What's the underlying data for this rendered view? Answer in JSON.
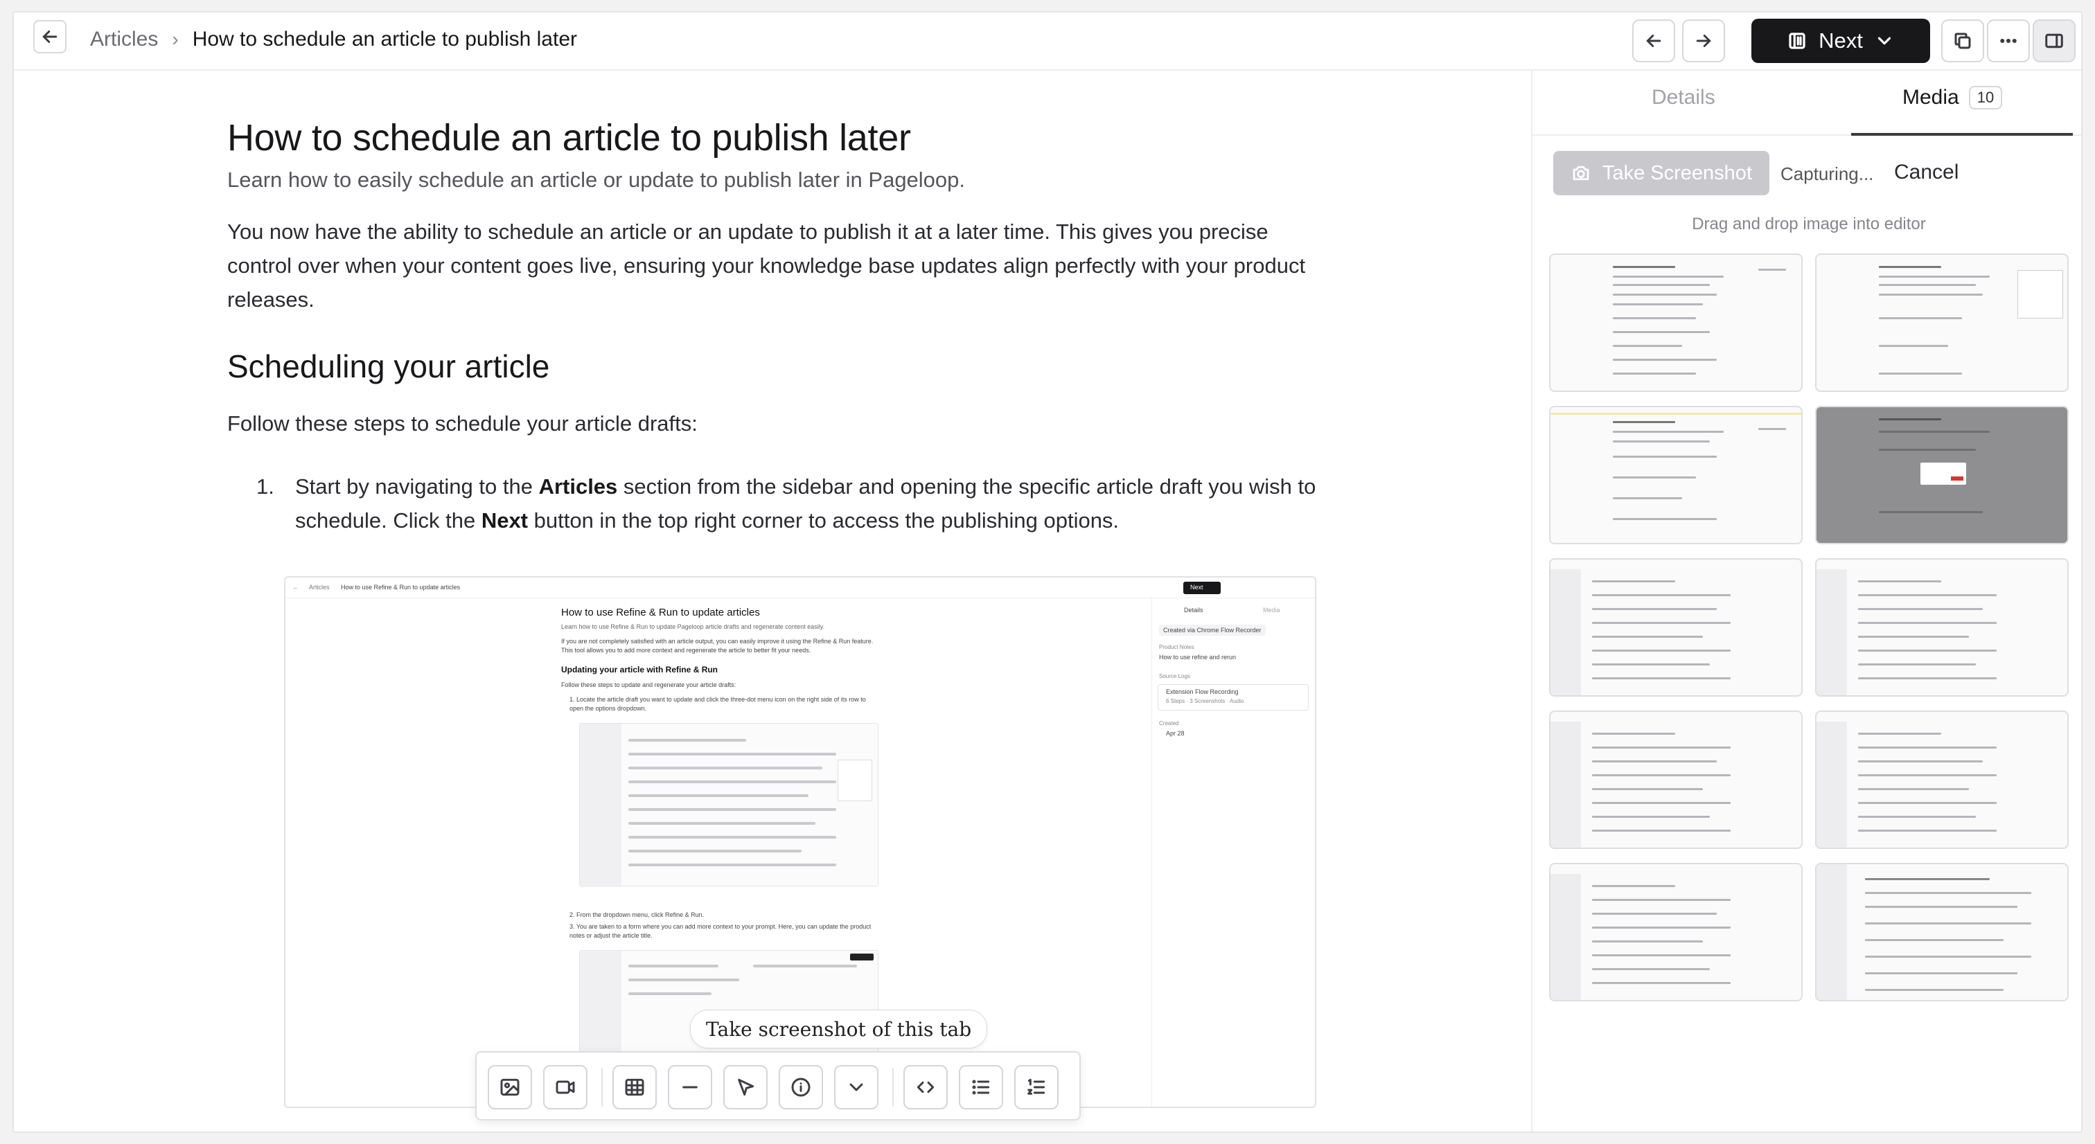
{
  "breadcrumb": {
    "root": "Articles",
    "separator": "›",
    "current": "How to schedule an article to publish later"
  },
  "toolbar": {
    "next_label": "Next"
  },
  "article": {
    "title": "How to schedule an article to publish later",
    "subtitle": "Learn how to easily schedule an article or update to publish later in Pageloop.",
    "intro": "You now have the ability to schedule an article or an update to publish it at a later time. This gives you precise control over when your content goes live, ensuring your knowledge base updates align perfectly with your product releases.",
    "section_heading": "Scheduling your article",
    "section_intro": "Follow these steps to schedule your article drafts:",
    "step1": {
      "number": "1.",
      "t1": "Start by navigating to the ",
      "b1": "Articles",
      "t2": " section from the sidebar and opening the specific article draft you wish to schedule. Click the ",
      "b2": "Next",
      "t3": " button in the top right corner to access the publishing options."
    }
  },
  "embedded": {
    "crumb_root": "Articles",
    "crumb_current": "How to use Refine & Run to update articles",
    "next": "Next",
    "title": "How to use Refine & Run to update articles",
    "subtitle": "Learn how to use Refine & Run to update Pageloop article drafts and regenerate content easily.",
    "intro": "If you are not completely satisfied with an article output, you can easily improve it using the Refine & Run feature. This tool allows you to add more context and regenerate the article to better fit your needs.",
    "heading": "Updating your article with Refine & Run",
    "follow": "Follow these steps to update and regenerate your article drafts:",
    "step1": "1. Locate the article draft you want to update and click the three-dot menu icon on the right side of its row to open the options dropdown.",
    "step2": "2. From the dropdown menu, click Refine & Run.",
    "step3": "3. You are taken to a form where you can add more context to your prompt. Here, you can update the product notes or adjust the article title.",
    "tabs": {
      "details": "Details",
      "media": "Media"
    },
    "created_via": "Created via Chrome Flow Recorder",
    "product_notes_label": "Product Notes",
    "product_notes": "How to use refine and rerun",
    "source_label": "Source Logs",
    "source_name": "Extension Flow Recording",
    "source_meta": "6 Steps · 3 Screenshots · Audio",
    "created_label": "Created",
    "created_date": "Apr 28"
  },
  "editor": {
    "tooltip": "Take screenshot of this tab"
  },
  "panel": {
    "tab_details": "Details",
    "tab_media": "Media",
    "media_count": "10",
    "take_screenshot": "Take Screenshot",
    "capturing": "Capturing...",
    "cancel": "Cancel",
    "hint": "Drag and drop image into editor"
  }
}
